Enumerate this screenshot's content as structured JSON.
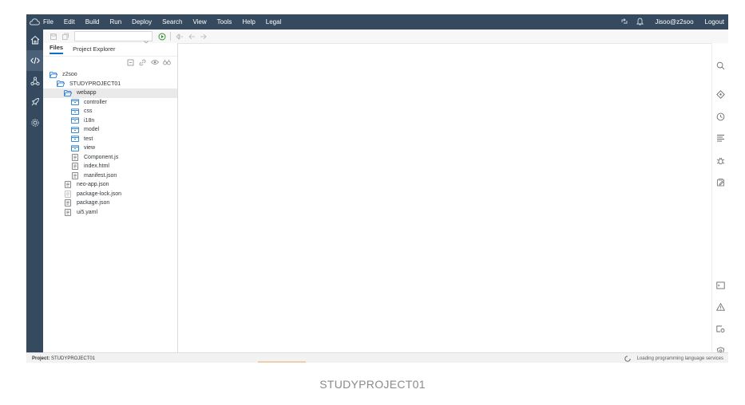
{
  "menubar": {
    "items": [
      "File",
      "Edit",
      "Build",
      "Run",
      "Deploy",
      "Search",
      "View",
      "Tools",
      "Help",
      "Legal"
    ],
    "user": "Jisoo@z2soo",
    "logout": "Logout"
  },
  "panel": {
    "tabs": [
      {
        "label": "Files",
        "active": true
      },
      {
        "label": "Project Explorer",
        "active": false
      }
    ]
  },
  "tree": [
    {
      "label": "z2soo",
      "type": "folder-open",
      "depth": 0
    },
    {
      "label": "STUDYPROJECT01",
      "type": "folder-open",
      "depth": 1
    },
    {
      "label": "webapp",
      "type": "folder-open",
      "depth": 2,
      "selected": true
    },
    {
      "label": "controller",
      "type": "folder",
      "depth": 3
    },
    {
      "label": "css",
      "type": "folder",
      "depth": 3
    },
    {
      "label": "i18n",
      "type": "folder",
      "depth": 3
    },
    {
      "label": "model",
      "type": "folder",
      "depth": 3
    },
    {
      "label": "test",
      "type": "folder",
      "depth": 3
    },
    {
      "label": "view",
      "type": "folder",
      "depth": 3
    },
    {
      "label": "Component.js",
      "type": "file",
      "depth": 3
    },
    {
      "label": "index.html",
      "type": "file",
      "depth": 3
    },
    {
      "label": "manifest.json",
      "type": "file",
      "depth": 3
    },
    {
      "label": "neo-app.json",
      "type": "file",
      "depth": 2
    },
    {
      "label": "package-lock.json",
      "type": "file-light",
      "depth": 2
    },
    {
      "label": "package.json",
      "type": "file",
      "depth": 2
    },
    {
      "label": "ui5.yaml",
      "type": "file",
      "depth": 2
    }
  ],
  "status": {
    "project_label": "Project:",
    "project_name": "STUDYPROJECT01",
    "loading": "Loading programming language services"
  },
  "caption": "STUDYPROJECT01",
  "colors": {
    "shell": "#354a5f",
    "accent": "#0a6ed1",
    "run_green": "#2b8c2b"
  }
}
